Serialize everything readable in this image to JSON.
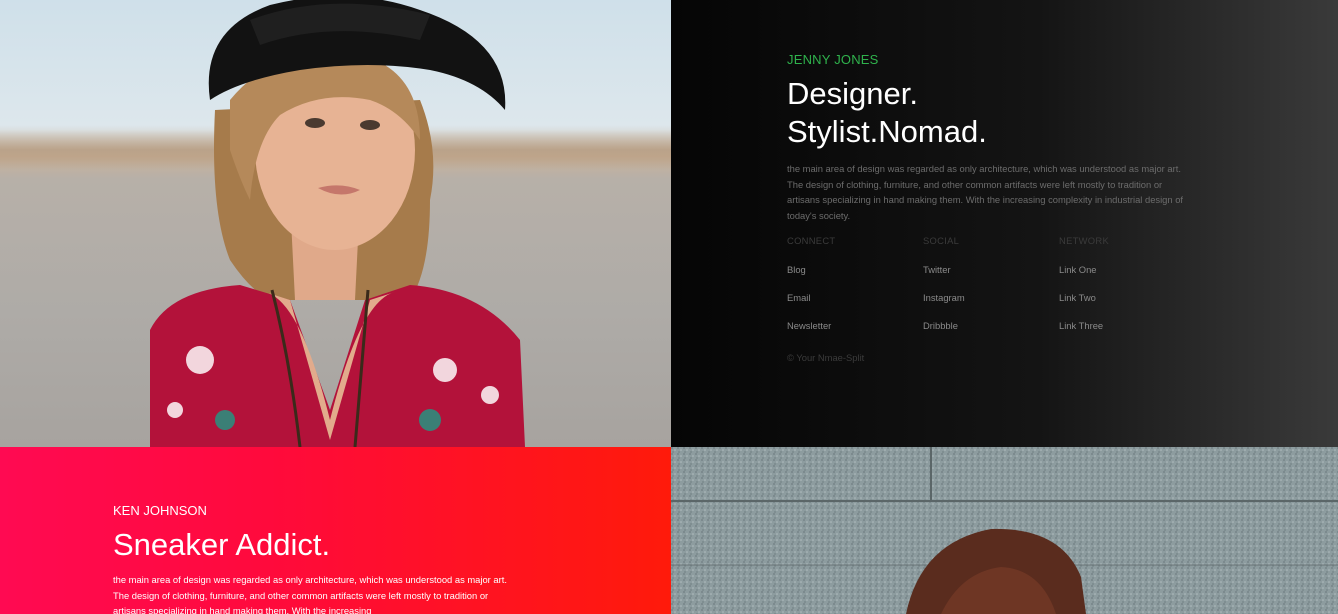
{
  "profile_one": {
    "name": "JENNY JONES",
    "headline_line1": "Designer.",
    "headline_line2": "Stylist.Nomad.",
    "description": "the main area of design was regarded as only architecture, which was understood as major art. The design of clothing, furniture, and other common artifacts were left mostly to tradition or artisans specializing in hand making them. With the increasing complexity in industrial design of today's society.",
    "columns": [
      {
        "heading": "CONNECT",
        "links": [
          "Blog",
          "Email",
          "Newsletter"
        ]
      },
      {
        "heading": "SOCIAL",
        "links": [
          "Twitter",
          "Instagram",
          "Dribbble"
        ]
      },
      {
        "heading": "NETWORK",
        "links": [
          "Link One",
          "Link Two",
          "Link Three"
        ]
      }
    ],
    "copyright": "© Your Nmae-Split",
    "accent_color": "#2fb24c"
  },
  "profile_two": {
    "name": "KEN JOHNSON",
    "headline": "Sneaker Addict.",
    "description": "the main area of design was regarded as only architecture, which was understood as major art. The design of clothing, furniture, and other common artifacts were left mostly to tradition or artisans specializing in hand making them. With the increasing",
    "background_colors": [
      "#ff0a52",
      "#ff1a0a"
    ]
  },
  "images": {
    "photo_one": "woman-in-black-hat-portrait",
    "photo_two": "woman-against-granite-wall"
  }
}
